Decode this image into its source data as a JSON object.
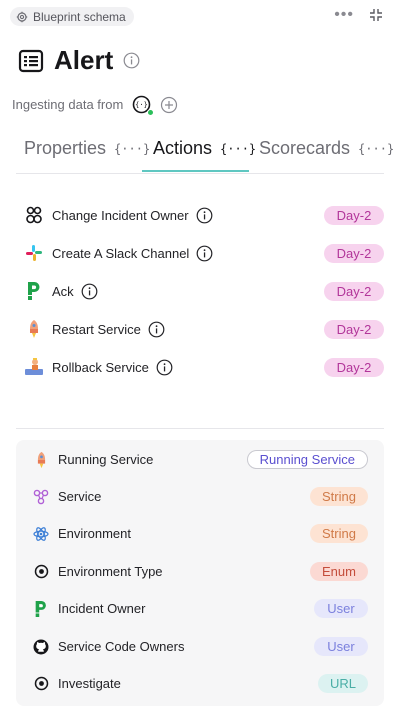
{
  "header": {
    "chip_label": "Blueprint schema",
    "more_label": "•••"
  },
  "title": "Alert",
  "ingest": {
    "label": "Ingesting data from"
  },
  "tabs": [
    {
      "label": "Properties",
      "suffix": "{···}",
      "active": false
    },
    {
      "label": "Actions",
      "suffix": "{···}",
      "active": true
    },
    {
      "label": "Scorecards",
      "suffix": "{···}",
      "active": false
    }
  ],
  "actions": [
    {
      "label": "Change Incident Owner",
      "badge": "Day-2",
      "icon": "people-icon"
    },
    {
      "label": "Create A Slack Channel",
      "badge": "Day-2",
      "icon": "slack-icon"
    },
    {
      "label": "Ack",
      "badge": "Day-2",
      "icon": "pagerduty-icon"
    },
    {
      "label": "Restart Service",
      "badge": "Day-2",
      "icon": "rocket-icon"
    },
    {
      "label": "Rollback Service",
      "badge": "Day-2",
      "icon": "worker-icon"
    }
  ],
  "properties": [
    {
      "label": "Running Service",
      "tag": "Running Service",
      "kind": "relation",
      "icon": "rocket-icon"
    },
    {
      "label": "Service",
      "tag": "String",
      "kind": "string",
      "icon": "microservice-icon"
    },
    {
      "label": "Environment",
      "tag": "String",
      "kind": "string",
      "icon": "environment-icon"
    },
    {
      "label": "Environment Type",
      "tag": "Enum",
      "kind": "enum",
      "icon": "radio-icon"
    },
    {
      "label": "Incident Owner",
      "tag": "User",
      "kind": "user",
      "icon": "pagerduty-icon"
    },
    {
      "label": "Service Code Owners",
      "tag": "User",
      "kind": "user",
      "icon": "github-icon"
    },
    {
      "label": "Investigate",
      "tag": "URL",
      "kind": "url",
      "icon": "radio-icon"
    }
  ],
  "colors": {
    "accent_underline": "#5fc7c1",
    "day2_bg": "#f7d3ee",
    "day2_text": "#b2369a"
  }
}
